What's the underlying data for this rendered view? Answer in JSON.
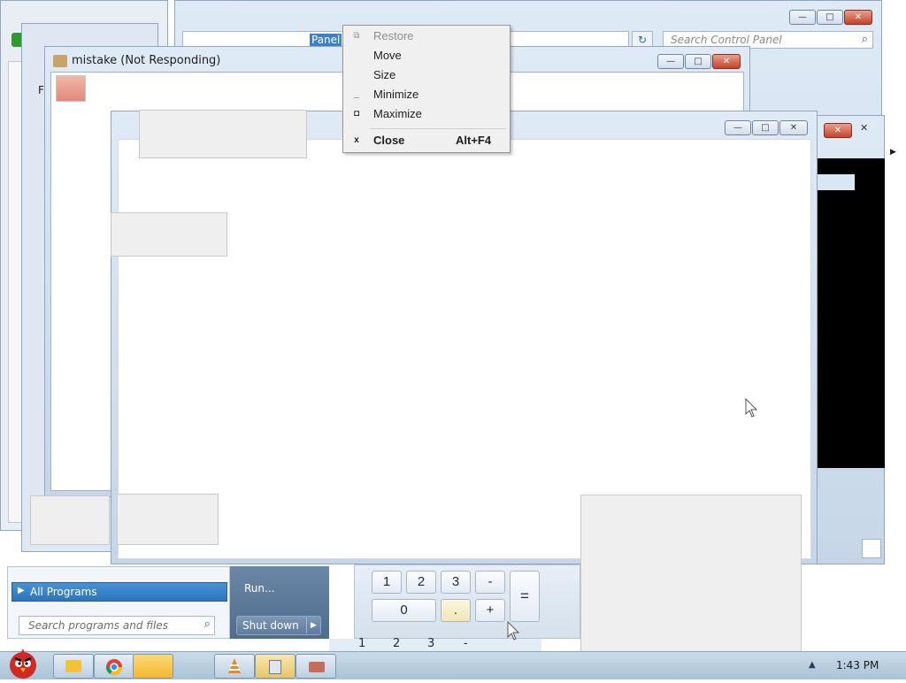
{
  "control_panel": {
    "address_text": "Panel",
    "search_placeholder": "Search Control Panel"
  },
  "mistake_window": {
    "title": "mistake (Not Responding)"
  },
  "system_menu": {
    "items": [
      {
        "label": "Restore",
        "icon": "restore-icon",
        "accelerator": "",
        "disabled": true
      },
      {
        "label": "Move",
        "icon": "",
        "accelerator": "",
        "disabled": false
      },
      {
        "label": "Size",
        "icon": "",
        "accelerator": "",
        "disabled": false
      },
      {
        "label": "Minimize",
        "icon": "minimize-icon",
        "accelerator": "",
        "disabled": false
      },
      {
        "label": "Maximize",
        "icon": "maximize-icon",
        "accelerator": "",
        "disabled": false
      },
      {
        "label": "Close",
        "icon": "close-icon",
        "accelerator": "Alt+F4",
        "disabled": false
      }
    ],
    "icon_glyphs": {
      "restore": "⧉",
      "minimize": "_",
      "maximize": "◘",
      "close": "x"
    }
  },
  "start_menu": {
    "all_programs": "All Programs",
    "search_placeholder": "Search programs and files",
    "run": "Run...",
    "shutdown": "Shut down"
  },
  "calculator": {
    "keys_row1": [
      "1",
      "2",
      "3",
      "-"
    ],
    "keys_row2": [
      "0",
      ".",
      "+"
    ],
    "equals": "=",
    "bg_keys": [
      "1",
      "2",
      "3",
      "-"
    ]
  },
  "window_buttons": {
    "minimize": "—",
    "maximize": "□",
    "close": "✕"
  },
  "partial_labels": {
    "left_f": "F",
    "left_f2": "F"
  },
  "clock": {
    "time": "1:43 PM"
  },
  "colors": {
    "accent": "#3c80c8",
    "close": "#c2432a",
    "taskbar": "#b5cde0"
  }
}
